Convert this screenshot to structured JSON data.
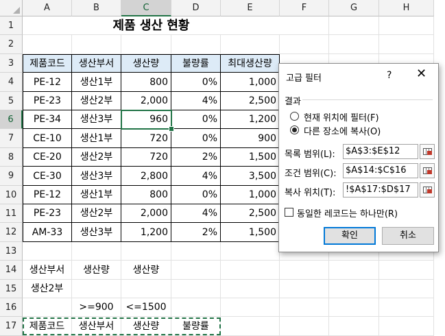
{
  "columns": [
    "A",
    "B",
    "C",
    "D",
    "E",
    "F",
    "G",
    "H"
  ],
  "rows": [
    "1",
    "2",
    "3",
    "4",
    "5",
    "6",
    "7",
    "8",
    "9",
    "10",
    "11",
    "12",
    "13",
    "14",
    "15",
    "16",
    "17"
  ],
  "title": "제품 생산 현황",
  "table": {
    "headers": [
      "제품코드",
      "생산부서",
      "생산량",
      "불량률",
      "최대생산량"
    ],
    "rows": [
      [
        "PE-12",
        "생산1부",
        "800",
        "0%",
        "1,000"
      ],
      [
        "PE-23",
        "생산2부",
        "2,000",
        "4%",
        "2,500"
      ],
      [
        "PE-34",
        "생산3부",
        "960",
        "0%",
        "1,200"
      ],
      [
        "CE-10",
        "생산1부",
        "720",
        "0%",
        "900"
      ],
      [
        "CE-20",
        "생산2부",
        "720",
        "2%",
        "1,500"
      ],
      [
        "CE-30",
        "생산3부",
        "2,800",
        "4%",
        "3,500"
      ],
      [
        "PE-12",
        "생산1부",
        "800",
        "0%",
        "1,000"
      ],
      [
        "PE-23",
        "생산2부",
        "2,000",
        "4%",
        "2,500"
      ],
      [
        "AM-33",
        "생산3부",
        "1,200",
        "2%",
        "1,500"
      ]
    ]
  },
  "criteria": {
    "headers": [
      "생산부서",
      "생산량",
      "생산량"
    ],
    "row1": [
      "생산2부",
      "",
      ""
    ],
    "row2": [
      "",
      ">=900",
      "<=1500"
    ]
  },
  "extract_headers": [
    "제품코드",
    "생산부서",
    "생산량",
    "불량률"
  ],
  "dialog": {
    "title": "고급 필터",
    "help": "?",
    "close": "✕",
    "section": "결과",
    "option_inplace": "현재 위치에 필터(F)",
    "option_copy": "다른 장소에 복사(O)",
    "selected": "copy",
    "list_label": "목록 범위(L):",
    "list_value": "$A$3:$E$12",
    "criteria_label": "조건 범위(C):",
    "criteria_value": "$A$14:$C$16",
    "copy_label": "복사 위치(T):",
    "copy_value": "!$A$17:$D$17",
    "unique_label": "동일한 레코드는 하나만(R)",
    "unique_checked": false,
    "ok": "확인",
    "cancel": "취소"
  }
}
